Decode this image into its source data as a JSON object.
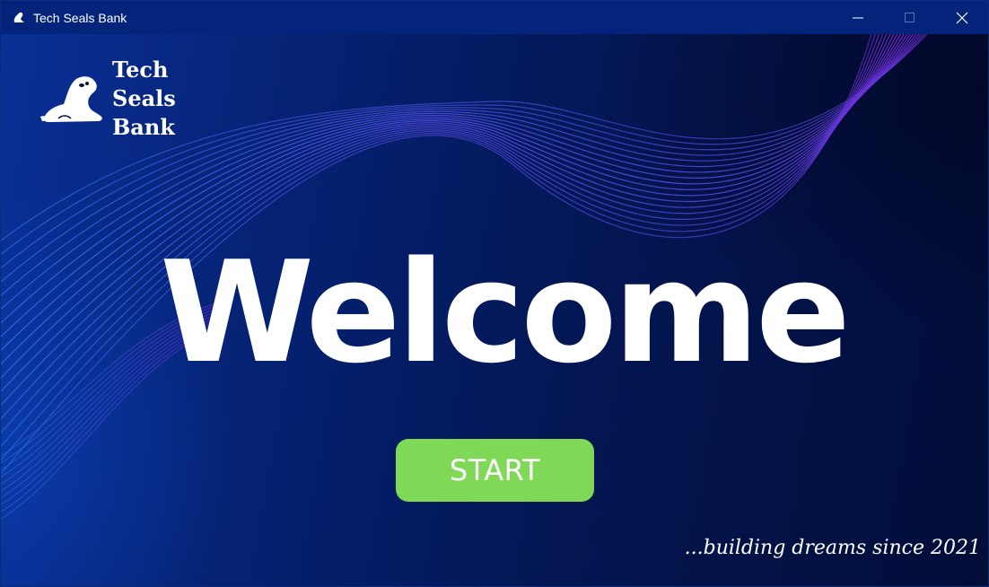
{
  "window": {
    "title": "Tech Seals Bank",
    "icon": "seal-icon"
  },
  "controls": {
    "minimize": "minimize-icon",
    "maximize": "maximize-icon",
    "close": "close-icon"
  },
  "logo": {
    "line1": "Tech",
    "line2": "Seals",
    "line3": "Bank",
    "icon": "seal-icon"
  },
  "welcome": "Welcome",
  "start_button": "START",
  "tagline": "...building dreams since 2021",
  "colors": {
    "titlebar": "#03247a",
    "background_start": "#0a2f96",
    "background_end": "#020d38",
    "button": "#7fd957",
    "wave_start": "#2a6fe0",
    "wave_end": "#7a2be0"
  }
}
